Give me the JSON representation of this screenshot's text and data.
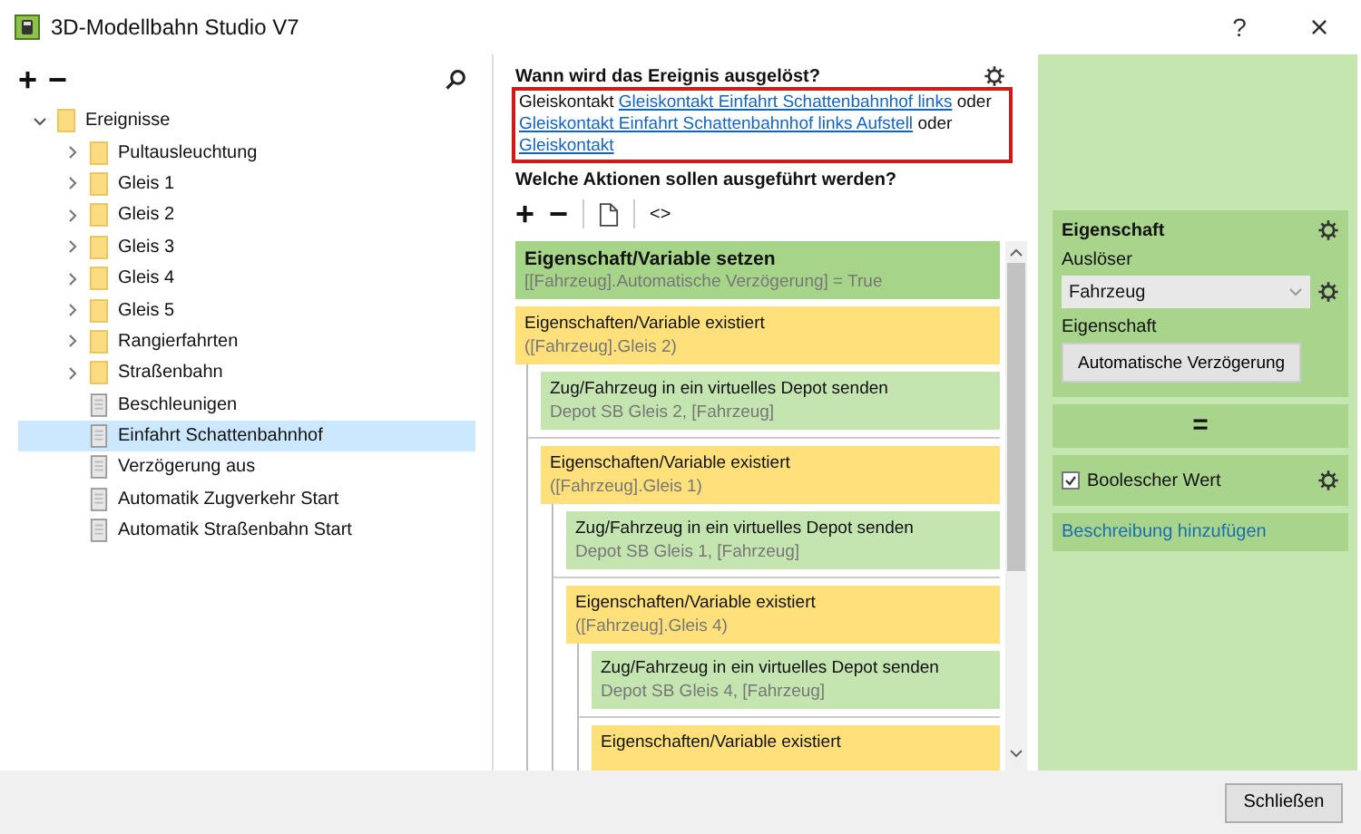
{
  "window": {
    "title": "3D-Modellbahn Studio V7",
    "help": "?",
    "close": "×"
  },
  "tree_toolbar": {
    "add": "+",
    "remove": "−"
  },
  "tree": {
    "items": [
      {
        "kind": "folder",
        "label": "Ereignisse",
        "expanded": true,
        "selected": false,
        "children": [
          {
            "kind": "folder",
            "label": "Pultausleuchtung",
            "expanded": false,
            "selected": false
          },
          {
            "kind": "folder",
            "label": "Gleis 1",
            "expanded": false,
            "selected": false
          },
          {
            "kind": "folder",
            "label": "Gleis 2",
            "expanded": false,
            "selected": false
          },
          {
            "kind": "folder",
            "label": "Gleis 3",
            "expanded": false,
            "selected": false
          },
          {
            "kind": "folder",
            "label": "Gleis 4",
            "expanded": false,
            "selected": false
          },
          {
            "kind": "folder",
            "label": "Gleis 5",
            "expanded": false,
            "selected": false
          },
          {
            "kind": "folder",
            "label": "Rangierfahrten",
            "expanded": false,
            "selected": false
          },
          {
            "kind": "folder",
            "label": "Straßenbahn",
            "expanded": false,
            "selected": false
          },
          {
            "kind": "file",
            "label": "Beschleunigen",
            "selected": false
          },
          {
            "kind": "file",
            "label": "Einfahrt Schattenbahnhof",
            "selected": true
          },
          {
            "kind": "file",
            "label": "Verzögerung aus",
            "selected": false
          },
          {
            "kind": "file",
            "label": "Automatik Zugverkehr Start",
            "selected": false
          },
          {
            "kind": "file",
            "label": "Automatik Straßenbahn Start",
            "selected": false
          }
        ]
      }
    ]
  },
  "trigger": {
    "heading": "Wann wird das Ereignis ausgelöst?",
    "parts": [
      {
        "kind": "text",
        "text": "Gleiskontakt"
      },
      {
        "kind": "link",
        "text": "Gleiskontakt Einfahrt Schattenbahnhof links"
      },
      {
        "kind": "text",
        "text": "oder"
      },
      {
        "kind": "link",
        "text": "Gleiskontakt Einfahrt Schattenbahnhof links Aufstell"
      },
      {
        "kind": "text",
        "text": "oder"
      },
      {
        "kind": "link",
        "text": "Gleiskontakt"
      }
    ]
  },
  "actions_heading": "Welche Aktionen sollen ausgeführt werden?",
  "actions_toolbar": {
    "add": "+",
    "remove": "−",
    "code": "<>"
  },
  "actions": [
    {
      "kind": "set",
      "title": "Eigenschaft/Variable setzen",
      "detail": "[[Fahrzeug].Automatische Verzögerung] = True"
    },
    {
      "kind": "condition",
      "title": "Eigenschaften/Variable existiert",
      "detail": "([Fahrzeug].Gleis 2)",
      "then": [
        {
          "kind": "send",
          "title": "Zug/Fahrzeug in ein virtuelles Depot senden",
          "detail": "Depot SB Gleis 2, [Fahrzeug]"
        }
      ],
      "else": [
        {
          "kind": "condition",
          "title": "Eigenschaften/Variable existiert",
          "detail": "([Fahrzeug].Gleis 1)",
          "then": [
            {
              "kind": "send",
              "title": "Zug/Fahrzeug in ein virtuelles Depot senden",
              "detail": "Depot SB Gleis 1, [Fahrzeug]"
            }
          ],
          "else": [
            {
              "kind": "condition",
              "title": "Eigenschaften/Variable existiert",
              "detail": "([Fahrzeug].Gleis 4)",
              "then": [
                {
                  "kind": "send",
                  "title": "Zug/Fahrzeug in ein virtuelles Depot senden",
                  "detail": "Depot SB Gleis 4, [Fahrzeug]"
                }
              ],
              "else": [
                {
                  "kind": "condition",
                  "title": "Eigenschaften/Variable existiert"
                }
              ]
            }
          ]
        }
      ]
    }
  ],
  "property": {
    "heading": "Eigenschaft",
    "trigger_label": "Auslöser",
    "trigger_value": "Fahrzeug",
    "property_label": "Eigenschaft",
    "property_button": "Automatische Verzögerung",
    "operator": "=",
    "value_label": "Boolescher Wert",
    "value_checked": true,
    "description_link": "Beschreibung hinzufügen"
  },
  "footer": {
    "close_button": "Schließen"
  }
}
